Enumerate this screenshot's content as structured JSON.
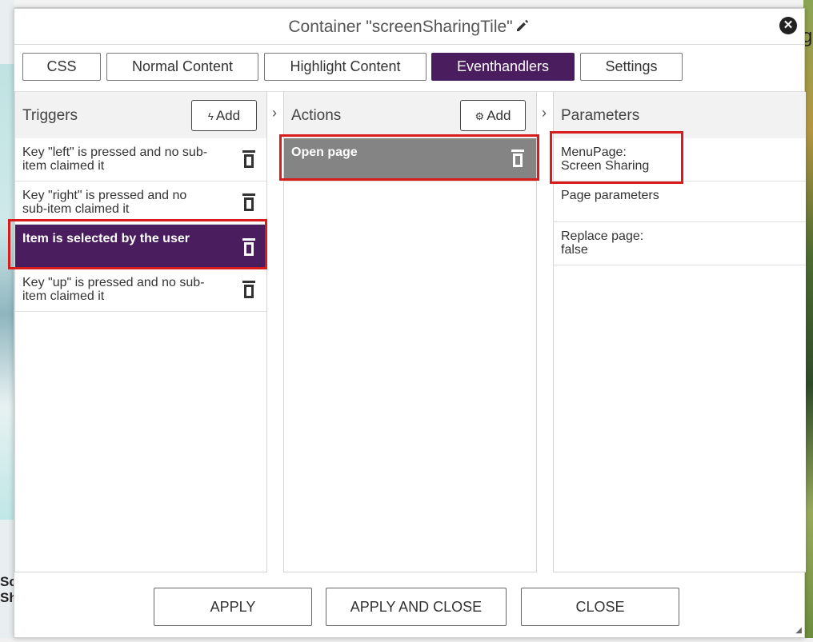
{
  "background": {
    "left_text_line1": "Sc",
    "left_text_line2": "Sh",
    "right_glyph": "g"
  },
  "dialog": {
    "title": "Container \"screenSharingTile\"",
    "tabs": [
      {
        "label": "CSS",
        "active": false
      },
      {
        "label": "Normal Content",
        "active": false
      },
      {
        "label": "Highlight Content",
        "active": false
      },
      {
        "label": "Eventhandlers",
        "active": true
      },
      {
        "label": "Settings",
        "active": false
      }
    ],
    "triggers": {
      "heading": "Triggers",
      "add_label": "Add",
      "items": [
        {
          "line1": "Key \"left\" is pressed and no sub-",
          "line2": "item claimed it",
          "selected": false
        },
        {
          "line1": "Key \"right\" is pressed and no",
          "line2": "sub-item claimed it",
          "selected": false
        },
        {
          "line1": "Item is selected by the user",
          "line2": "",
          "selected": true
        },
        {
          "line1": "Key \"up\" is pressed and no sub-",
          "line2": "item claimed it",
          "selected": false
        }
      ]
    },
    "actions": {
      "heading": "Actions",
      "add_label": "Add",
      "items": [
        {
          "label": "Open page",
          "selected": true
        }
      ]
    },
    "parameters": {
      "heading": "Parameters",
      "items": [
        {
          "line1": "MenuPage:",
          "line2": "Screen Sharing"
        },
        {
          "line1": "Page parameters",
          "line2": ""
        },
        {
          "line1": "Replace page:",
          "line2": "false"
        }
      ]
    },
    "footer": {
      "apply": "APPLY",
      "apply_close": "APPLY AND CLOSE",
      "close": "CLOSE"
    }
  },
  "colors": {
    "accent": "#4a1e5e",
    "selected_action": "#848484",
    "highlight_box": "#d81b1b"
  }
}
